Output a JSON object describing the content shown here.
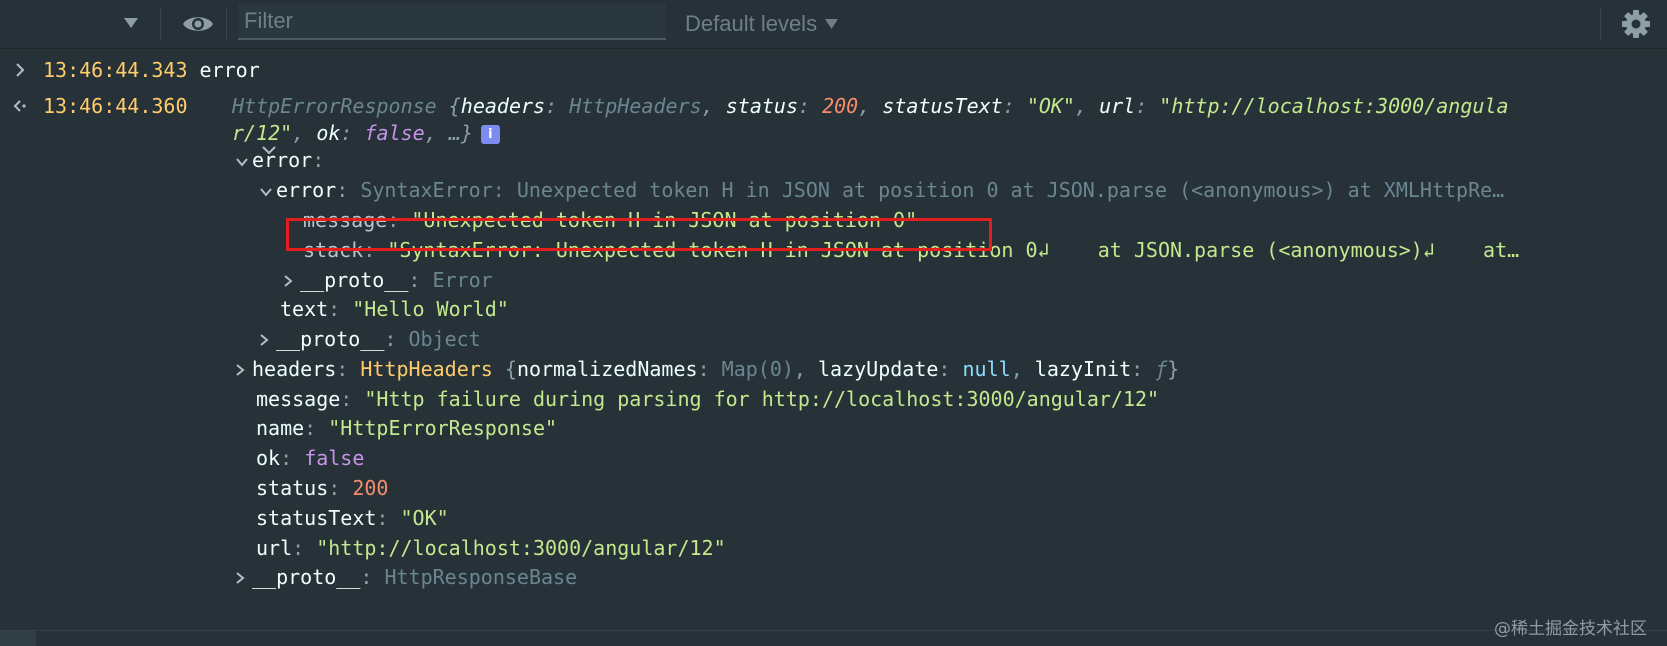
{
  "toolbar": {
    "filter_placeholder": "Filter",
    "levels_label": "Default levels",
    "icons": [
      "chevron-down-icon",
      "eye-icon",
      "gear-icon"
    ]
  },
  "colors": {
    "background": "#263238",
    "timestamp": "#ffcb6b",
    "string": "#c3e88d",
    "number": "#f78c6c",
    "keyword": "#c792ea",
    "highlight_border": "#e41d1d"
  },
  "messages": [
    {
      "timestamp": "13:46:44.343",
      "text": "error"
    },
    {
      "timestamp": "13:46:44.360",
      "summary": {
        "class_name": "HttpErrorResponse",
        "headers_key": "headers",
        "headers_val": "HttpHeaders",
        "status_key": "status",
        "status_val": "200",
        "statusText_key": "statusText",
        "statusText_val": "\"OK\"",
        "url_key": "url",
        "url_val_part1": "\"http://localhost:3000/angula",
        "url_val_part2": "r/12\"",
        "ok_key": "ok",
        "ok_val": "false",
        "more": "…}",
        "info_badge": "i"
      },
      "tree": {
        "error_key": "error",
        "inner_error_key": "error",
        "inner_error_val": "SyntaxError: Unexpected token H in JSON at position 0 at JSON.parse (<anonymous>) at XMLHttpRe…",
        "message_key": "message",
        "message_val": "\"Unexpected token H in JSON at position 0\"",
        "stack_key": "stack",
        "stack_val": "\"SyntaxError: Unexpected token H in JSON at position 0↲    at JSON.parse (<anonymous>)↲    at…",
        "proto_key": "__proto__",
        "proto_error_val": "Error",
        "text_key": "text",
        "text_val": "\"Hello World\"",
        "proto_object_val": "Object",
        "headers_key": "headers",
        "headers_class": "HttpHeaders",
        "normalizedNames_key": "normalizedNames",
        "normalizedNames_val": "Map(0)",
        "lazyUpdate_key": "lazyUpdate",
        "lazyUpdate_val": "null",
        "lazyInit_key": "lazyInit",
        "lazyInit_val": "ƒ",
        "message2_key": "message",
        "message2_val": "\"Http failure during parsing for http://localhost:3000/angular/12\"",
        "name_key": "name",
        "name_val": "\"HttpErrorResponse\"",
        "ok_key": "ok",
        "ok_val": "false",
        "status_key": "status",
        "status_val": "200",
        "statusText_key": "statusText",
        "statusText_val": "\"OK\"",
        "url_key": "url",
        "url_val": "\"http://localhost:3000/angular/12\"",
        "proto_base_val": "HttpResponseBase"
      }
    }
  ],
  "watermark": "@稀土掘金技术社区"
}
